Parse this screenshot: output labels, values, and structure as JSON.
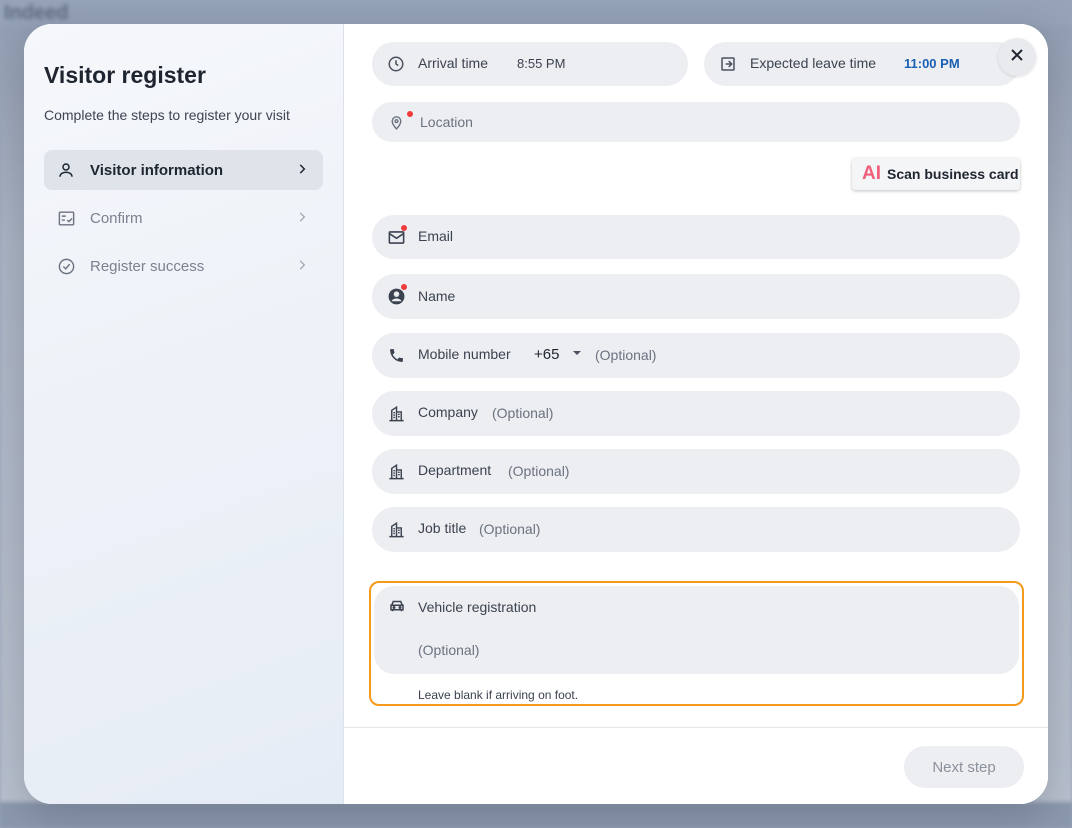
{
  "background": {
    "brand": "Indeed"
  },
  "sidebar": {
    "title": "Visitor register",
    "subtitle": "Complete the steps to register your visit",
    "steps": [
      {
        "label": "Visitor information",
        "icon": "person-icon",
        "active": true
      },
      {
        "label": "Confirm",
        "icon": "checklist-icon",
        "active": false
      },
      {
        "label": "Register success",
        "icon": "check-circle-icon",
        "active": false
      }
    ]
  },
  "form": {
    "arrival": {
      "label": "Arrival time",
      "value": "8:55 PM"
    },
    "leave": {
      "label": "Expected leave time",
      "value": "11:00 PM"
    },
    "location": {
      "placeholder": "Location"
    },
    "scan": {
      "ai": "AI",
      "label": "Scan business card"
    },
    "email": {
      "label": "Email"
    },
    "name": {
      "label": "Name"
    },
    "mobile": {
      "label": "Mobile number",
      "country_code": "+65",
      "optional": "(Optional)"
    },
    "company": {
      "label": "Company",
      "optional": "(Optional)"
    },
    "department": {
      "label": "Department",
      "optional": "(Optional)"
    },
    "job_title": {
      "label": "Job title",
      "optional": "(Optional)"
    },
    "vehicle": {
      "label": "Vehicle registration",
      "optional": "(Optional)",
      "helper": "Leave blank if arriving on foot."
    }
  },
  "footer": {
    "next_label": "Next step"
  },
  "colors": {
    "accent_blue": "#1a5fb4",
    "required_red": "#ef3b3b",
    "focus_orange": "#f59a1d",
    "ai_pink": "#f0607e"
  }
}
